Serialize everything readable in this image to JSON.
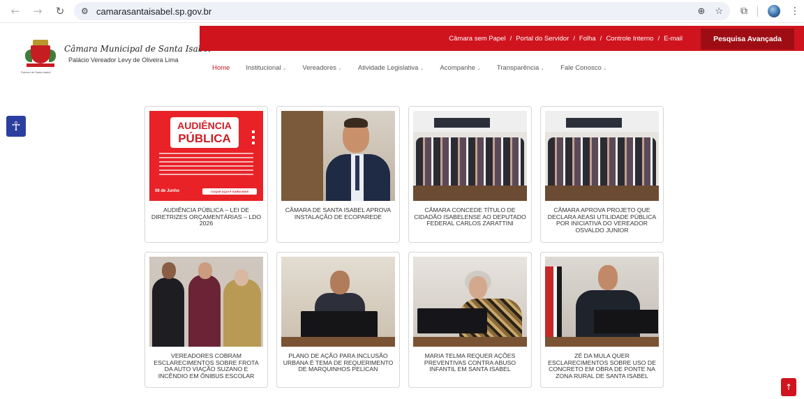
{
  "browser": {
    "url": "camarasantaisabel.sp.gov.br",
    "icons": [
      "back-icon",
      "forward-icon",
      "reload-icon",
      "site-settings-icon",
      "zoom-icon",
      "bookmark-star-icon",
      "extensions-icon",
      "profile-avatar",
      "menu-kebab-icon"
    ]
  },
  "header": {
    "site_name": "Câmara Municipal de Santa Isabel",
    "site_subtitle": "Palácio Vereador Levy de Oliveira Lima",
    "crest_motto": "Paroeci de Santa Isabel",
    "top_links": [
      "Câmara sem Papel",
      "Portal do Servidor",
      "Folha",
      "Controle Interno",
      "E-mail"
    ],
    "search_button": "Pesquisa Avançada",
    "nav": [
      {
        "label": "Home",
        "active": true,
        "dropdown": false
      },
      {
        "label": "Institucional",
        "active": false,
        "dropdown": true
      },
      {
        "label": "Vereadores",
        "active": false,
        "dropdown": true
      },
      {
        "label": "Atividade Legislativa",
        "active": false,
        "dropdown": true
      },
      {
        "label": "Acompanhe",
        "active": false,
        "dropdown": true
      },
      {
        "label": "Transparência",
        "active": false,
        "dropdown": true
      },
      {
        "label": "Fale Conosco",
        "active": false,
        "dropdown": true
      }
    ],
    "brand_color": "#d0141e"
  },
  "accessibility": {
    "icon": "accessibility-icon"
  },
  "news": [
    {
      "title": "AUDIÊNCIA PÚBLICA – LEI DE DIRETRIZES ORÇAMENTÁRIAS – LDO 2026",
      "image_text": {
        "line1": "AUDIÊNCIA",
        "line2": "PÚBLICA",
        "date": "08 de Junho",
        "cta": "CLIQUE AQUI E SAIBA MAIS"
      }
    },
    {
      "title": "CÂMARA DE SANTA ISABEL APROVA INSTALAÇÃO DE ECOPAREDE"
    },
    {
      "title": "CÂMARA CONCEDE TÍTULO DE CIDADÃO ISABELENSE AO DEPUTADO FEDERAL CARLOS ZARATTINI"
    },
    {
      "title": "CÂMARA APROVA PROJETO QUE DECLARA AEASI UTILIDADE PÚBLICA POR INICIATIVA DO VEREADOR OSVALDO JUNIOR"
    },
    {
      "title": "VEREADORES COBRAM ESCLARECIMENTOS SOBRE FROTA DA AUTO VIAÇÃO SUZANO E INCÊNDIO EM ÔNIBUS ESCOLAR"
    },
    {
      "title": "PLANO DE AÇÃO PARA INCLUSÃO URBANA É TEMA DE REQUERIMENTO DE MARQUINHOS PELICAN"
    },
    {
      "title": "MARIA TELMA REQUER AÇÕES PREVENTIVAS CONTRA ABUSO INFANTIL EM SANTA ISABEL"
    },
    {
      "title": "ZÉ DA MULA QUER ESCLARECIMENTOS SOBRE USO DE CONCRETO EM OBRA DE PONTE NA ZONA RURAL DE SANTA ISABEL"
    }
  ],
  "back_to_top": {
    "icon": "arrow-up-icon"
  }
}
